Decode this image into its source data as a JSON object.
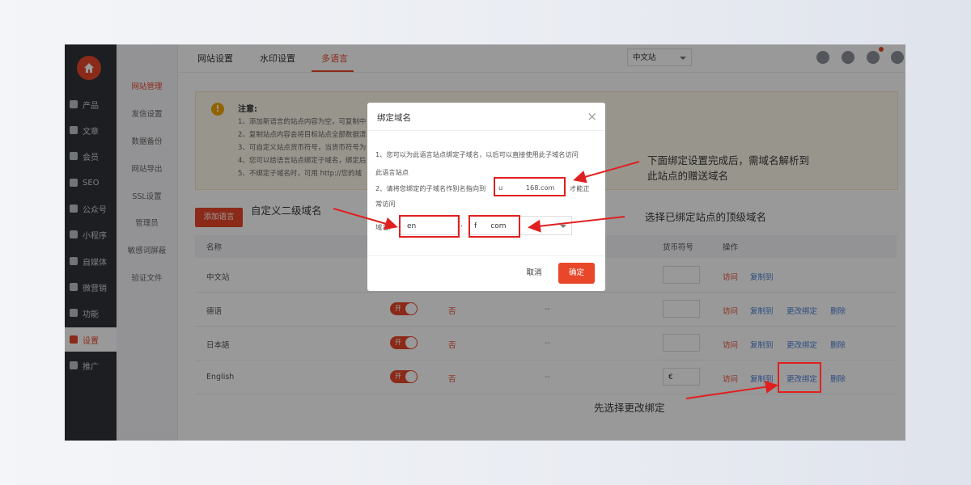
{
  "sidebar": {
    "items": [
      {
        "label": "产品",
        "icon": "grid-icon"
      },
      {
        "label": "文章",
        "icon": "document-icon"
      },
      {
        "label": "会员",
        "icon": "users-icon"
      },
      {
        "label": "SEO",
        "icon": "file-icon"
      },
      {
        "label": "公众号",
        "icon": "wechat-icon"
      },
      {
        "label": "小程序",
        "icon": "miniprogram-icon"
      },
      {
        "label": "自媒体",
        "icon": "media-icon"
      },
      {
        "label": "微营销",
        "icon": "marketing-icon"
      },
      {
        "label": "功能",
        "icon": "puzzle-icon"
      },
      {
        "label": "设置",
        "icon": "gear-icon"
      },
      {
        "label": "推广",
        "icon": "chart-icon"
      }
    ]
  },
  "subnav": {
    "items": [
      "网站管理",
      "发信设置",
      "数据备份",
      "网站导出",
      "SSL设置",
      "管理员",
      "敏感词屏蔽",
      "验证文件"
    ]
  },
  "topbar": {
    "tabs": [
      "网站设置",
      "水印设置",
      "多语言"
    ],
    "site_select": "中文站"
  },
  "notice": {
    "title": "注意:",
    "lines": [
      "1、添加新语言的站点内容为空，可复制中",
      "2、复制站点内容会将目标站点全部数据清",
      "3、可自定义站点货币符号，当货币符号为",
      "4、您可以给语言站点绑定子域名，绑定后",
      "5、不绑定子域名时，可用 http://您的域"
    ]
  },
  "add_button": "添加语言",
  "table": {
    "headers": [
      "名称",
      "货币符号",
      "操作"
    ],
    "rows": [
      {
        "name": "中文站",
        "toggle": "",
        "default": "",
        "domain": "",
        "currency": "",
        "actions": [
          "访问",
          "复制到"
        ]
      },
      {
        "name": "德语",
        "toggle": "开",
        "default": "否",
        "domain": "--",
        "currency": "",
        "actions": [
          "访问",
          "复制到",
          "更改绑定",
          "删除"
        ]
      },
      {
        "name": "日本語",
        "toggle": "开",
        "default": "否",
        "domain": "--",
        "currency": "",
        "actions": [
          "访问",
          "复制到",
          "更改绑定",
          "删除"
        ]
      },
      {
        "name": "English",
        "toggle": "开",
        "default": "否",
        "domain": "--",
        "currency": "€",
        "actions": [
          "访问",
          "复制到",
          "更改绑定",
          "删除"
        ]
      }
    ]
  },
  "dialog": {
    "title": "绑定域名",
    "close": "×",
    "line1": "1、您可以为此语言站点绑定子域名，以后可以直接使用此子域名访问",
    "line1b": "此语言站点",
    "line2a": "2、请将您绑定的子域名作别名指向到",
    "cname_target": "u           168.com",
    "line2b": "才能正",
    "line2c": "常访问",
    "domain_label": "域名:",
    "subdomain_value": "en",
    "dot": ".",
    "top_domain_value": "f      com",
    "cancel": "取消",
    "confirm": "确定"
  },
  "annotations": {
    "cname_note_1": "下面绑定设置完成后，需域名解析到",
    "cname_note_2": "此站点的赠送域名",
    "subdomain_note": "自定义二级域名",
    "topdomain_note": "选择已绑定站点的顶级域名",
    "change_bind_note": "先选择更改绑定"
  },
  "colors": {
    "accent": "#e8472a",
    "link_blue": "#4a7fd6",
    "annotation_red": "#e02020"
  }
}
